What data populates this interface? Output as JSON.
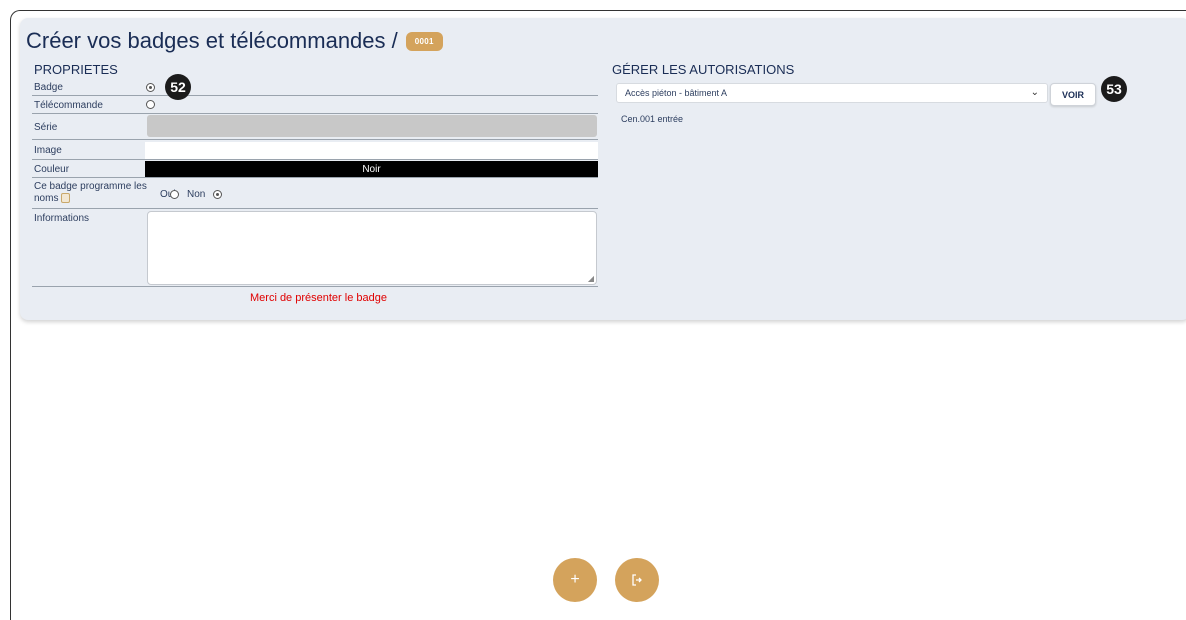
{
  "header": {
    "title": "Créer vos badges et télécommandes /",
    "code_badge": "0001"
  },
  "properties": {
    "section_title": "PROPRIETES",
    "badge_label": "Badge",
    "badge_marker": "52",
    "remote_label": "Télécommande",
    "serie_label": "Série",
    "image_label": "Image",
    "color_label": "Couleur",
    "color_value": "Noir",
    "program_label_line1": "Ce badge programme les",
    "program_label_line2": "noms",
    "oui_label": "Oui",
    "non_label": "Non",
    "informations_label": "Informations",
    "warning": "Merci de présenter le badge"
  },
  "authorizations": {
    "section_title": "GÉRER LES AUTORISATIONS",
    "select_value": "Accès piéton - bâtiment A",
    "voir_label": "VOIR",
    "voir_marker": "53",
    "entry_text": "Cen.001 entrée"
  },
  "actions": {
    "add_icon": "+",
    "exit_icon": "exit-icon"
  },
  "colors": {
    "accent": "#d4a35c",
    "warning": "#e00000",
    "card_bg": "#e9edf3"
  }
}
